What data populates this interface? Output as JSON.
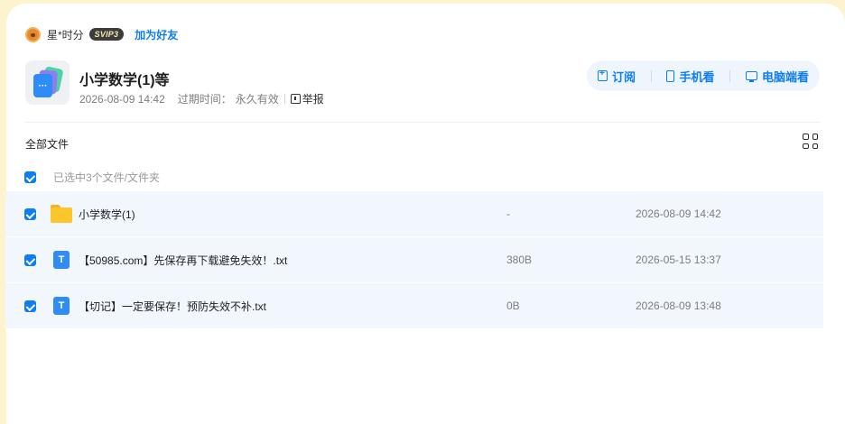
{
  "user": {
    "name": "星*时分",
    "vip_badge": "SVIP3",
    "add_friend_label": "加为好友"
  },
  "share": {
    "title": "小学数学(1)等",
    "created_at": "2026-08-09 14:42",
    "expire_label": "过期时间：",
    "expire_value": "永久有效",
    "report_label": "举报",
    "icon_glyph": "···"
  },
  "actions": {
    "subscribe_label": "订阅",
    "mobile_label": "手机看",
    "pc_label": "电脑端看"
  },
  "files": {
    "section_label": "全部文件",
    "selection_summary": "已选中3个文件/文件夹",
    "rows": [
      {
        "type": "folder",
        "name": "小学数学(1)",
        "size": "-",
        "date": "2026-08-09 14:42",
        "checked": true
      },
      {
        "type": "txt",
        "type_glyph": "T",
        "name": "【50985.com】先保存再下载避免失效！.txt",
        "size": "380B",
        "date": "2026-05-15 13:37",
        "checked": true
      },
      {
        "type": "txt",
        "type_glyph": "T",
        "name": "【切记】一定要保存！预防失效不补.txt",
        "size": "0B",
        "date": "2026-08-09 13:48",
        "checked": true
      }
    ]
  },
  "colors": {
    "accent": "#0d7df4",
    "page_background": "#fdf3cf",
    "row_highlight": "#f1f7fd"
  }
}
